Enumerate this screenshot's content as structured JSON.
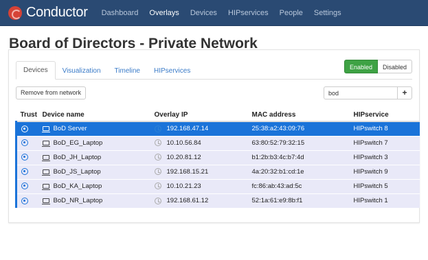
{
  "app": {
    "brand": "Conductor",
    "nav": [
      {
        "label": "Dashboard"
      },
      {
        "label": "Overlays"
      },
      {
        "label": "Devices"
      },
      {
        "label": "HIPservices"
      },
      {
        "label": "People"
      },
      {
        "label": "Settings"
      }
    ]
  },
  "page": {
    "title": "Board of Directors - Private Network"
  },
  "tabs": [
    {
      "label": "Devices"
    },
    {
      "label": "Visualization"
    },
    {
      "label": "Timeline"
    },
    {
      "label": "HIPservices"
    }
  ],
  "toggle": {
    "enabled": "Enabled",
    "disabled": "Disabled",
    "state": "Enabled"
  },
  "toolbar": {
    "remove_label": "Remove from network",
    "search_value": "bod",
    "add_label": "+"
  },
  "table": {
    "headers": [
      "Trust",
      "Device name",
      "Overlay IP",
      "MAC address",
      "HIPservice"
    ],
    "rows": [
      {
        "name": "BoD Server",
        "ip": "192.168.47.14",
        "mac": "25:38:a2:43:09:76",
        "hip": "HIPswitch 8",
        "selected": true
      },
      {
        "name": "BoD_EG_Laptop",
        "ip": "10.10.56.84",
        "mac": "63:80:52:79:32:15",
        "hip": "HIPswitch 7"
      },
      {
        "name": "BoD_JH_Laptop",
        "ip": "10.20.81.12",
        "mac": "b1:2b:b3:4c:b7:4d",
        "hip": "HIPswitch 3"
      },
      {
        "name": "BoD_JS_Laptop",
        "ip": "192.168.15.21",
        "mac": "4a:20:32:b1:cd:1e",
        "hip": "HIPswitch 9"
      },
      {
        "name": "BoD_KA_Laptop",
        "ip": "10.10.21.23",
        "mac": "fc:86:ab:43:ad:5c",
        "hip": "HIPswitch 5"
      },
      {
        "name": "BoD_NR_Laptop",
        "ip": "192.168.61.12",
        "mac": "52:1a:61:e9:8b:f1",
        "hip": "HIPswitch 1"
      }
    ]
  },
  "colors": {
    "navbar": "#2a4a73",
    "accent": "#1a73d9",
    "enabled": "#3ea244",
    "row_bg": "#e9e9f8"
  },
  "icons": {
    "trust": "radio-icon",
    "device": "laptop-icon",
    "ip": "clock-icon",
    "brand": "conductor-logo-icon"
  }
}
